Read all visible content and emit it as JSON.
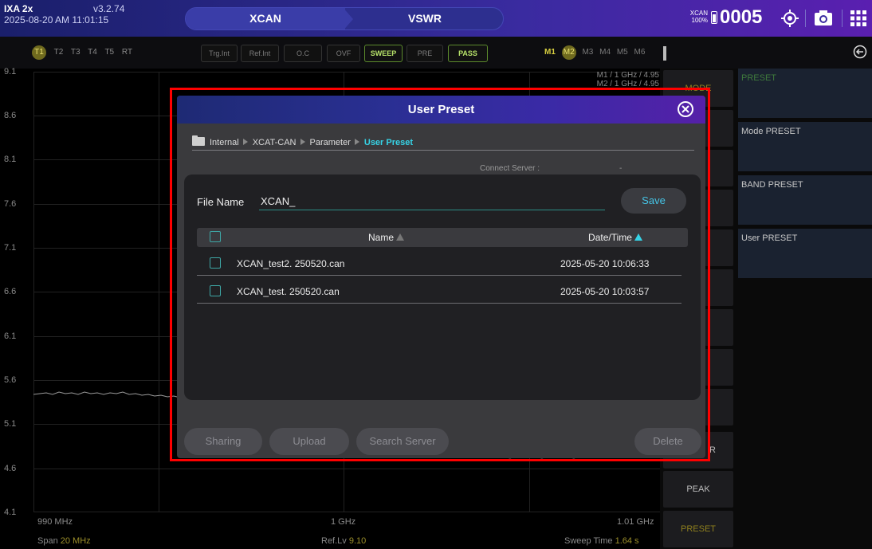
{
  "topbar": {
    "model": "IXA 2x",
    "version": "v3.2.74",
    "datetime": "2025-08-20 AM 11:01:15",
    "mode_left": "XCAN",
    "mode_right": "VSWR",
    "badge_line1": "XCAN",
    "badge_line2": "100%",
    "counter": "0005",
    "icons": [
      "battery-icon",
      "target-icon",
      "camera-icon",
      "grid-icon"
    ]
  },
  "traces": [
    "T1",
    "T2",
    "T3",
    "T4",
    "T5",
    "RT"
  ],
  "status_buttons": [
    {
      "label": "Trg.Int",
      "on": false
    },
    {
      "label": "Ref.Int",
      "on": false
    },
    {
      "label": "O.C",
      "on": false
    },
    {
      "label": "OVF",
      "on": false
    },
    {
      "label": "SWEEP",
      "on": true
    },
    {
      "label": "PRE",
      "on": false
    },
    {
      "label": "PASS",
      "on": true
    }
  ],
  "markers": [
    "M1",
    "M2",
    "M3",
    "M4",
    "M5",
    "M6"
  ],
  "plot": {
    "y_ticks": [
      "9.1",
      "8.6",
      "8.1",
      "7.6",
      "7.1",
      "6.6",
      "6.1",
      "5.6",
      "5.1",
      "4.6",
      "4.1"
    ],
    "x_start": "990 MHz",
    "x_center": "1 GHz",
    "x_end": "1.01 GHz",
    "span_label": "Span",
    "span_value": "20 MHz",
    "reflv_label": "Ref.Lv",
    "reflv_value": "9.10",
    "sweep_label": "Sweep Time",
    "sweep_value": "1.64 s",
    "marker_line1": "M1 / 1 GHz / 4.95",
    "marker_line2": "M2 / 1 GHz / 4.95"
  },
  "softkeys": {
    "mode": "MODE",
    "peak": "PEAK",
    "preset": "PRESET",
    "partial_r": "R"
  },
  "side_menu": [
    "PRESET",
    "Mode PRESET",
    "BAND PRESET",
    "User PRESET"
  ],
  "dialog": {
    "title": "User Preset",
    "breadcrumb": [
      "Internal",
      "XCAT-CAN",
      "Parameter",
      "User Preset"
    ],
    "connect_label": "Connect Server :",
    "connect_value": "-",
    "file_name_label": "File Name",
    "file_name_value": "XCAN_",
    "save_label": "Save",
    "col_name": "Name",
    "col_date": "Date/Time",
    "rows": [
      {
        "name": "XCAN_test2. 250520.can",
        "date": "2025-05-20 10:06:33"
      },
      {
        "name": "XCAN_test. 250520.can",
        "date": "2025-05-20 10:03:57"
      }
    ],
    "buttons": [
      "Sharing",
      "Upload",
      "Search Server",
      "Delete"
    ]
  },
  "colors": {
    "accent_cyan": "#36d3e6",
    "highlight_frame": "#ff0000",
    "trace_yellow": "#9c8f2a"
  }
}
